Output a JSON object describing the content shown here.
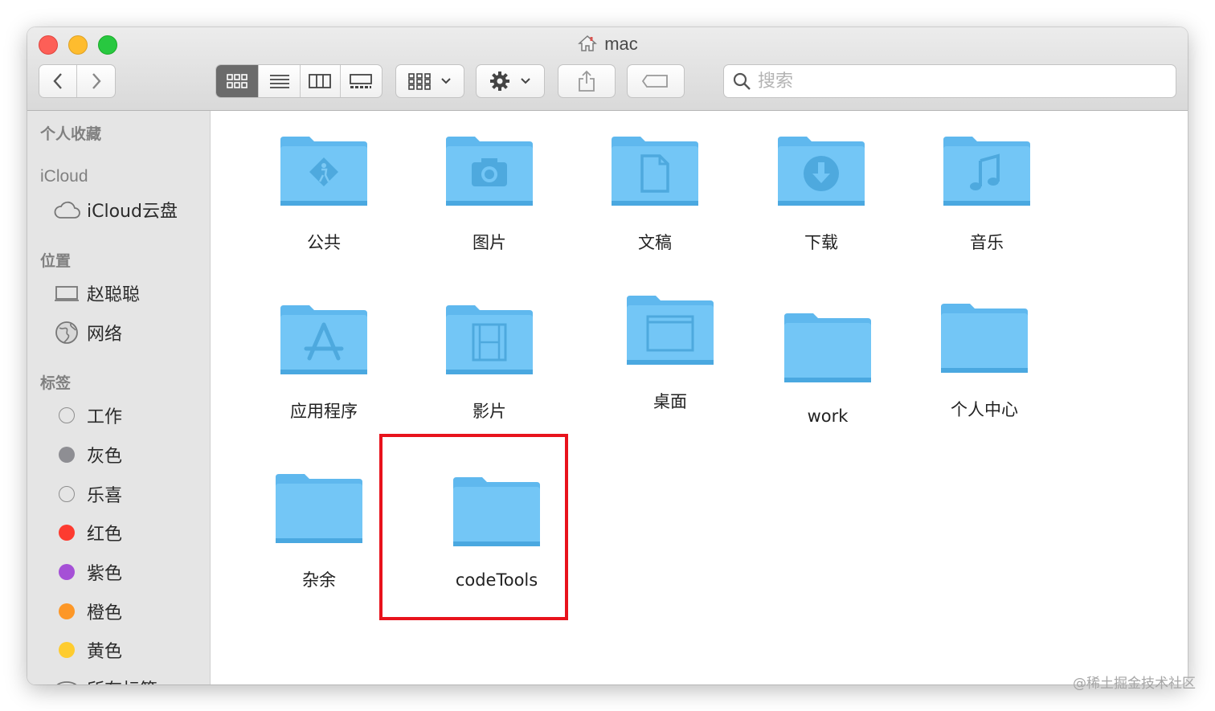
{
  "window": {
    "title": "mac"
  },
  "toolbar": {
    "back_icon": "chevron-left-icon",
    "forward_icon": "chevron-right-icon",
    "view_modes": [
      "icon-view",
      "list-view",
      "column-view",
      "gallery-view"
    ],
    "active_view": "icon-view",
    "group_icon": "grid-icon",
    "action_icon": "gear-icon",
    "share_icon": "share-icon",
    "tag_icon": "tag-icon"
  },
  "search": {
    "placeholder": "搜索"
  },
  "sidebar": {
    "favorites_heading": "个人收藏",
    "icloud_heading": "iCloud",
    "icloud_drive": "iCloud云盘",
    "locations_heading": "位置",
    "computer": "赵聪聪",
    "network": "网络",
    "tags_heading": "标签",
    "tags": [
      {
        "label": "工作",
        "color": "none"
      },
      {
        "label": "灰色",
        "color": "#8e8e93"
      },
      {
        "label": "乐喜",
        "color": "none"
      },
      {
        "label": "红色",
        "color": "#fd3b30"
      },
      {
        "label": "紫色",
        "color": "#a550d6"
      },
      {
        "label": "橙色",
        "color": "#fd9727"
      },
      {
        "label": "黄色",
        "color": "#fecc2f"
      }
    ],
    "all_tags": "所有标签..."
  },
  "files": [
    {
      "name": "公共",
      "icon": "public-folder-icon"
    },
    {
      "name": "图片",
      "icon": "pictures-folder-icon"
    },
    {
      "name": "文稿",
      "icon": "documents-folder-icon"
    },
    {
      "name": "下载",
      "icon": "downloads-folder-icon"
    },
    {
      "name": "音乐",
      "icon": "music-folder-icon"
    },
    {
      "name": "应用程序",
      "icon": "applications-folder-icon"
    },
    {
      "name": "影片",
      "icon": "movies-folder-icon"
    },
    {
      "name": "桌面",
      "icon": "desktop-folder-icon"
    },
    {
      "name": "work",
      "icon": "folder-icon"
    },
    {
      "name": "个人中心",
      "icon": "folder-icon"
    },
    {
      "name": "杂余",
      "icon": "folder-icon"
    },
    {
      "name": "codeTools",
      "icon": "folder-icon"
    }
  ],
  "colors": {
    "folder": "#6cc4f5",
    "highlight": "#e8131c"
  },
  "watermark": "@稀土掘金技术社区"
}
